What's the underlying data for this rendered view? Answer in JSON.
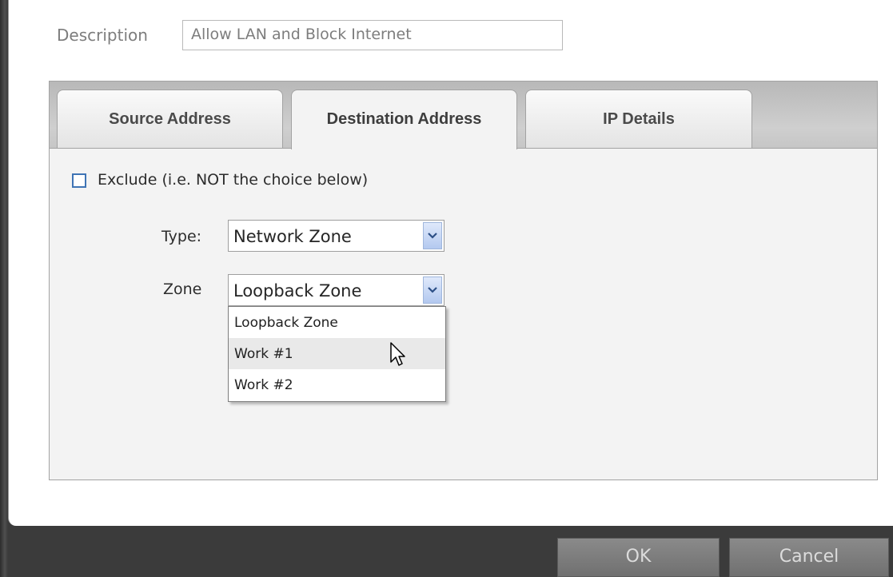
{
  "form": {
    "description_label": "Description",
    "description_value": "Allow LAN and Block Internet"
  },
  "tabs": [
    {
      "label": "Source Address",
      "active": false
    },
    {
      "label": "Destination Address",
      "active": true
    },
    {
      "label": "IP Details",
      "active": false
    }
  ],
  "destination": {
    "exclude_label": "Exclude (i.e. NOT the choice below)",
    "exclude_checked": false,
    "type_label": "Type:",
    "type_value": "Network Zone",
    "zone_label": "Zone",
    "zone_value": "Loopback Zone",
    "zone_options": [
      "Loopback Zone",
      "Work #1",
      "Work #2"
    ],
    "zone_hovered_option": "Work #1"
  },
  "footer": {
    "ok_label": "OK",
    "cancel_label": "Cancel"
  },
  "colors": {
    "accent": "#3f74b5",
    "dropdown_button": "#b3c9ef",
    "footer_background": "#3b3b3b"
  },
  "icons": {
    "dropdown": "chevron-down-icon",
    "cursor": "mouse-pointer-icon"
  }
}
